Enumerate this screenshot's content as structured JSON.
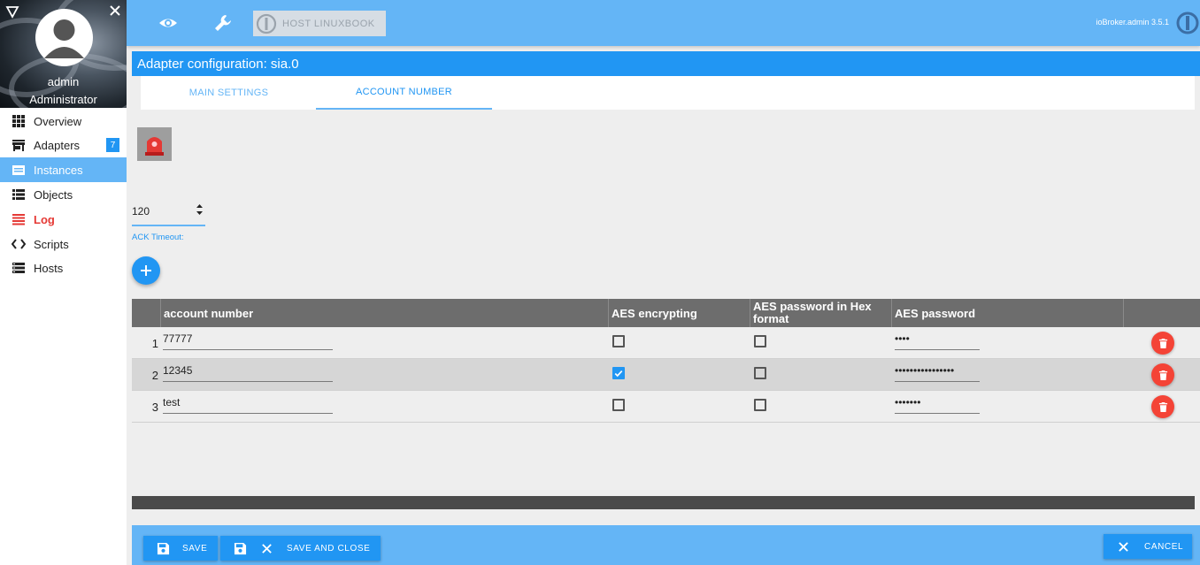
{
  "sidebar": {
    "username": "admin",
    "role": "Administrator",
    "items": [
      {
        "label": "Overview",
        "icon": "apps-grid-icon"
      },
      {
        "label": "Adapters",
        "icon": "store-icon",
        "badge": "7"
      },
      {
        "label": "Instances",
        "icon": "instances-icon",
        "active": true
      },
      {
        "label": "Objects",
        "icon": "list-icon"
      },
      {
        "label": "Log",
        "icon": "log-icon"
      },
      {
        "label": "Scripts",
        "icon": "code-icon"
      },
      {
        "label": "Hosts",
        "icon": "storage-icon"
      }
    ]
  },
  "topbar": {
    "host_label": "HOST LINUXBOOK",
    "version": "ioBroker.admin 3.5.1"
  },
  "dialog": {
    "title": "Adapter configuration: sia.0",
    "tabs": [
      {
        "label": "MAIN SETTINGS",
        "active": false
      },
      {
        "label": "ACCOUNT NUMBER",
        "active": true
      }
    ]
  },
  "ack": {
    "value": "120",
    "label": "ACK Timeout:"
  },
  "table": {
    "columns": [
      "account number",
      "AES encrypting",
      "AES password in Hex format",
      "AES password"
    ],
    "rows": [
      {
        "num": "1",
        "account": "77777",
        "aes": false,
        "hex": false,
        "password": "••••"
      },
      {
        "num": "2",
        "account": "12345",
        "aes": true,
        "hex": false,
        "password": "••••••••••••••••"
      },
      {
        "num": "3",
        "account": "test",
        "aes": false,
        "hex": false,
        "password": "•••••••"
      }
    ]
  },
  "buttons": {
    "save": "SAVE",
    "save_close": "SAVE AND CLOSE",
    "cancel": "CANCEL"
  },
  "colors": {
    "primary": "#2196f3",
    "light_primary": "#64b5f6",
    "delete": "#f44336",
    "log": "#e53935"
  }
}
